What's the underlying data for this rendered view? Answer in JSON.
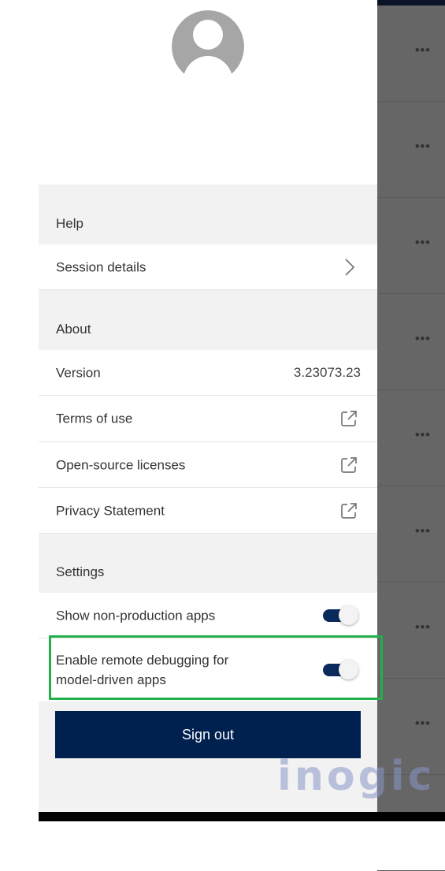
{
  "overlay": {
    "row_count": 9,
    "more_label": "•••"
  },
  "profile": {
    "avatar": "default-person-avatar"
  },
  "sections": {
    "help": {
      "title": "Help"
    },
    "about": {
      "title": "About"
    },
    "settings": {
      "title": "Settings"
    }
  },
  "help_items": {
    "session_details": {
      "label": "Session details",
      "icon": "chevron-right-icon"
    }
  },
  "about_items": {
    "version": {
      "label": "Version",
      "value": "3.23073.23"
    },
    "terms": {
      "label": "Terms of use",
      "icon": "open-external-icon"
    },
    "licenses": {
      "label": "Open-source licenses",
      "icon": "open-external-icon"
    },
    "privacy": {
      "label": "Privacy Statement",
      "icon": "open-external-icon"
    }
  },
  "settings_items": {
    "non_production": {
      "label": "Show non-production apps",
      "checked": true
    },
    "remote_debugging": {
      "label": "Enable remote debugging for model-driven apps",
      "checked": true
    }
  },
  "sign_out": {
    "label": "Sign out"
  },
  "watermark": {
    "text": "inogic"
  },
  "colors": {
    "accent": "#00204f",
    "toggle_on": "#0a2a5c",
    "highlight": "#22b04a",
    "section_bg": "#f2f2f2"
  }
}
